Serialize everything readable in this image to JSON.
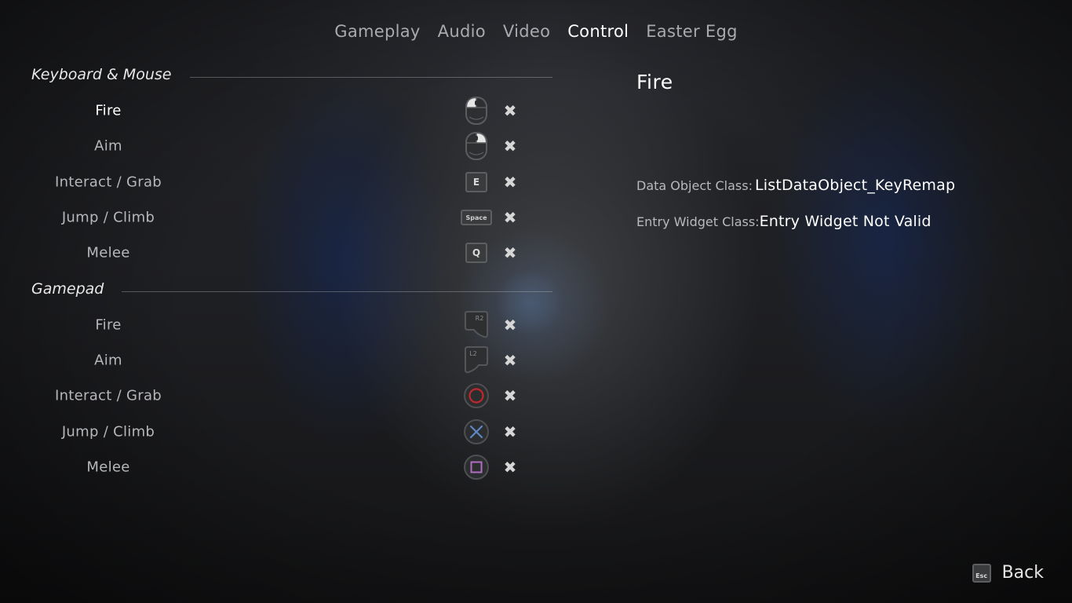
{
  "tabs": [
    {
      "label": "Gameplay",
      "active": false
    },
    {
      "label": "Audio",
      "active": false
    },
    {
      "label": "Video",
      "active": false
    },
    {
      "label": "Control",
      "active": true
    },
    {
      "label": "Easter Egg",
      "active": false
    }
  ],
  "keyboard_section": {
    "title": "Keyboard & Mouse",
    "rows": [
      {
        "label": "Fire",
        "icon": "mouse-left-click-icon",
        "selected": true
      },
      {
        "label": "Aim",
        "icon": "mouse-right-click-icon",
        "selected": false
      },
      {
        "label": "Interact / Grab",
        "key": "E",
        "icon": "key-e-icon",
        "selected": false
      },
      {
        "label": "Jump / Climb",
        "key": "Space",
        "icon": "key-space-icon",
        "selected": false
      },
      {
        "label": "Melee",
        "key": "Q",
        "icon": "key-q-icon",
        "selected": false
      }
    ]
  },
  "gamepad_section": {
    "title": "Gamepad",
    "rows": [
      {
        "label": "Fire",
        "key": "R2",
        "icon": "r2-trigger-icon"
      },
      {
        "label": "Aim",
        "key": "L2",
        "icon": "l2-trigger-icon"
      },
      {
        "label": "Interact / Grab",
        "icon": "circle-button-icon",
        "color": "#c0282d"
      },
      {
        "label": "Jump / Climb",
        "icon": "cross-button-icon",
        "color": "#5e86c4"
      },
      {
        "label": "Melee",
        "icon": "square-button-icon",
        "color": "#b06fc0"
      }
    ]
  },
  "remove_icon": "close-icon",
  "details": {
    "title": "Fire",
    "data_object_label": "Data Object Class:",
    "data_object_value": "ListDataObject_KeyRemap",
    "entry_widget_label": "Entry Widget Class:",
    "entry_widget_value": "Entry Widget Not Valid"
  },
  "back": {
    "key": "Esc",
    "label": "Back"
  }
}
